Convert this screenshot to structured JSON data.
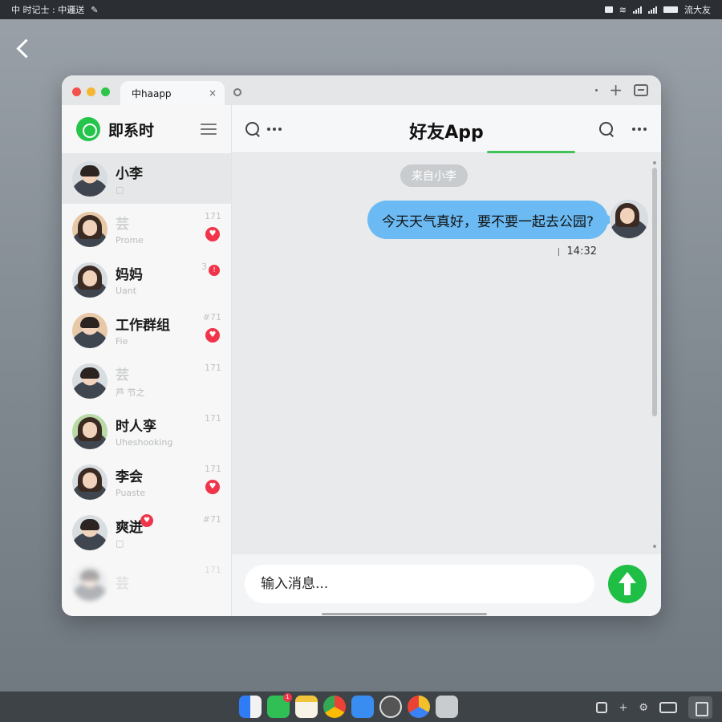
{
  "status_bar": {
    "left_text": "中 时记士 : 中邏送",
    "right_text": "流大友"
  },
  "window": {
    "tab_title": "中haapp",
    "tab_close": "×",
    "new_tab": "+"
  },
  "sidebar": {
    "title": "即系时",
    "contacts": [
      {
        "name": "小李",
        "sub": "▢",
        "time": "",
        "badge": "",
        "active": true
      },
      {
        "name": "芸",
        "sub": "Prome",
        "time": "171",
        "badge": "♥"
      },
      {
        "name": "妈妈",
        "sub": "Uant",
        "time": "3",
        "badge": "!"
      },
      {
        "name": "工作群组",
        "sub": "Fie",
        "time": "#71",
        "badge": "♥"
      },
      {
        "name": "芸",
        "sub": "芦 节之",
        "time": "171",
        "badge": ""
      },
      {
        "name": "时人孪",
        "sub": "Uheshooking",
        "time": "171",
        "badge": ""
      },
      {
        "name": "李会",
        "sub": "Puaste",
        "time": "171",
        "badge": "♥"
      },
      {
        "name": "爽迸",
        "sub": "▢",
        "time": "#71",
        "badge": "♥"
      },
      {
        "name": "芸",
        "sub": "",
        "time": "171",
        "badge": ""
      }
    ]
  },
  "chat": {
    "title": "好友App",
    "date_label": "来自小李",
    "messages": [
      {
        "text": "今天天气真好，要不要一起去公园?",
        "time": "14:32",
        "outgoing": true
      }
    ],
    "input_placeholder": "输入消息..."
  },
  "colors": {
    "accent_green": "#1fbe44",
    "bubble_blue": "#6cbaf3",
    "badge_red": "#f0344a"
  },
  "dock": {
    "badge": "1"
  },
  "icons": [
    "back-icon",
    "whatsapp-icon",
    "hamburger-icon",
    "search-icon",
    "more-icon",
    "send-icon"
  ]
}
